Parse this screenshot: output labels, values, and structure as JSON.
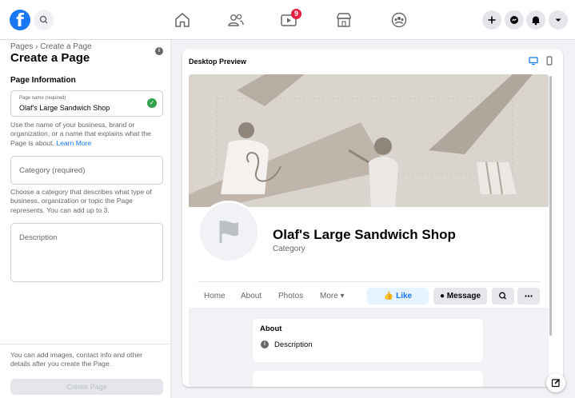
{
  "topbar": {
    "logo_letter": "f",
    "notification_count": "9",
    "icons": [
      "facebook-logo",
      "search-icon",
      "home-icon",
      "friends-icon",
      "watch-icon",
      "marketplace-icon",
      "groups-icon",
      "plus-icon",
      "messenger-icon",
      "bell-icon",
      "caret-down-icon"
    ]
  },
  "sidebar": {
    "breadcrumb": "Pages › Create a Page",
    "title": "Create a Page",
    "section_heading": "Page Information",
    "page_name_label": "Page name (required)",
    "page_name_value": "Olaf's Large Sandwich Shop",
    "page_name_help": "Use the name of your business, brand or organization, or a name that explains what the Page is about.",
    "learn_more": "Learn More",
    "category_placeholder": "Category (required)",
    "category_help": "Choose a category that describes what type of business, organization or topic the Page represents. You can add up to 3.",
    "description_placeholder": "Description",
    "footer_text": "You can add images, contact info and other details after you create the Page.",
    "create_button": "Create Page"
  },
  "preview": {
    "title": "Desktop Preview",
    "page_name": "Olaf's Large Sandwich Shop",
    "category": "Category",
    "tabs": [
      "Home",
      "About",
      "Photos",
      "More ▾"
    ],
    "like_label": "Like",
    "message_label": "Message",
    "about_heading": "About",
    "about_description": "Description"
  },
  "colors": {
    "accent": "#1877f2",
    "success": "#31a24c",
    "badge": "#e41e3f",
    "cover": "#d9d4ce"
  }
}
